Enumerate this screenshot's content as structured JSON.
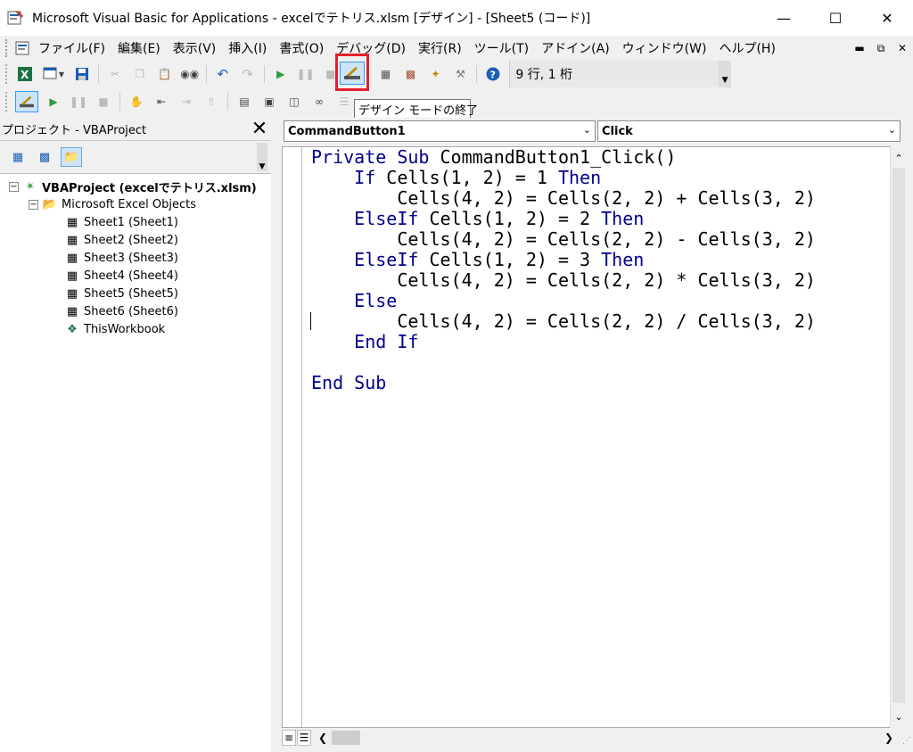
{
  "title": "Microsoft Visual Basic for Applications - excelでテトリス.xlsm [デザイン] - [Sheet5 (コード)]",
  "menu": [
    "ファイル(F)",
    "編集(E)",
    "表示(V)",
    "挿入(I)",
    "書式(O)",
    "デバッグ(D)",
    "実行(R)",
    "ツール(T)",
    "アドイン(A)",
    "ウィンドウ(W)",
    "ヘルプ(H)"
  ],
  "toolbar": {
    "status": "9 行, 1 桁"
  },
  "tooltip": "デザイン モードの終了",
  "project": {
    "title": "プロジェクト - VBAProject",
    "root": "VBAProject (excelでテトリス.xlsm)",
    "folder": "Microsoft Excel Objects",
    "items": [
      "Sheet1 (Sheet1)",
      "Sheet2 (Sheet2)",
      "Sheet3 (Sheet3)",
      "Sheet4 (Sheet4)",
      "Sheet5 (Sheet5)",
      "Sheet6 (Sheet6)",
      "ThisWorkbook"
    ]
  },
  "code": {
    "object": "CommandButton1",
    "procedure": "Click",
    "lines": [
      "Private Sub CommandButton1_Click()",
      "    If Cells(1, 2) = 1 Then",
      "        Cells(4, 2) = Cells(2, 2) + Cells(3, 2)",
      "    ElseIf Cells(1, 2) = 2 Then",
      "        Cells(4, 2) = Cells(2, 2) - Cells(3, 2)",
      "    ElseIf Cells(1, 2) = 3 Then",
      "        Cells(4, 2) = Cells(2, 2) * Cells(3, 2)",
      "    Else",
      "        Cells(4, 2) = Cells(2, 2) / Cells(3, 2)",
      "    End If",
      "",
      "End Sub"
    ]
  },
  "colors": {
    "keyword": "#00008b",
    "highlight": "#e0202a",
    "selection": "#cde4f7"
  }
}
